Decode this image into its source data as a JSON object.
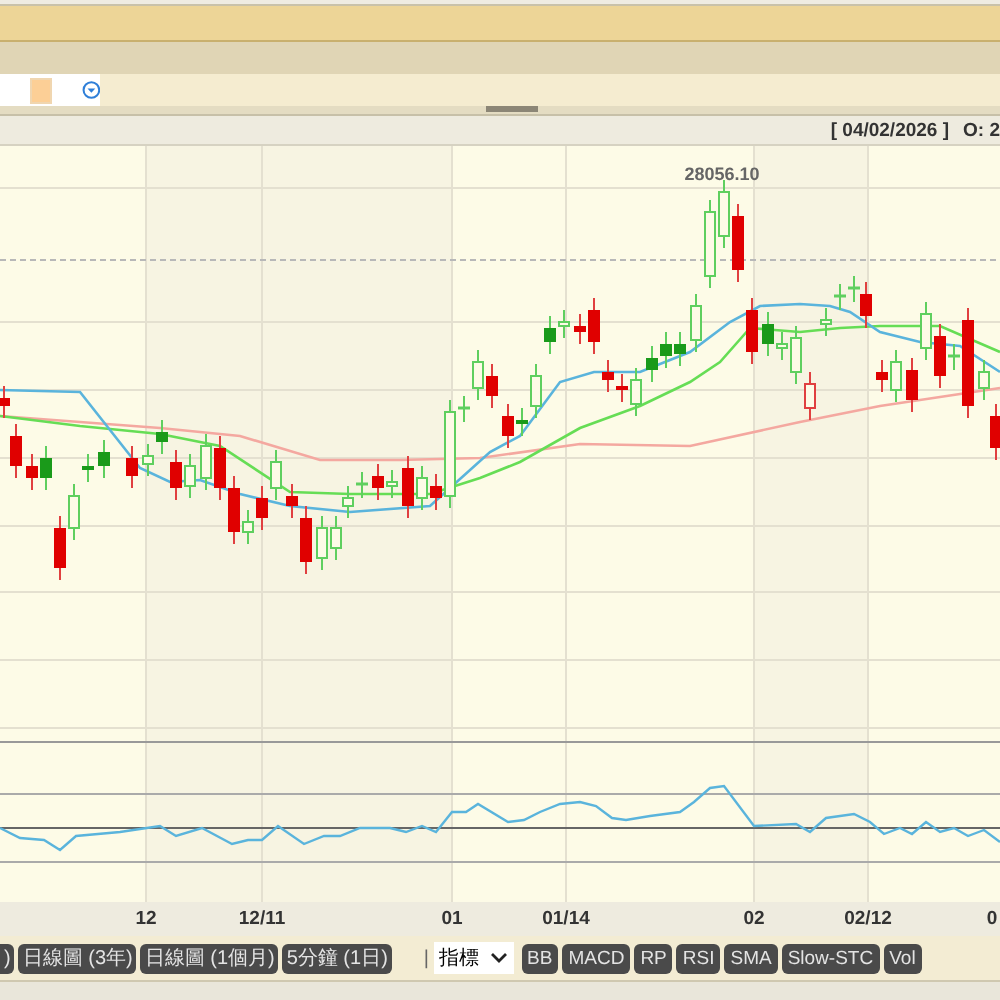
{
  "header": {
    "date": "[ 04/02/2026 ]",
    "open_label": "O: 2"
  },
  "chart": {
    "high_label": "28056.10",
    "x_labels": [
      "12",
      "12/11",
      "01",
      "01/14",
      "02",
      "02/12",
      "0"
    ]
  },
  "toolbar": {
    "range_buttons": [
      ")",
      "日線圖 (3年)",
      "日線圖 (1個月)",
      "5分鐘 (1日)"
    ],
    "separator": "|",
    "indicator_select": "指標",
    "indicator_buttons": [
      "BB",
      "MACD",
      "RP",
      "RSI",
      "SMA",
      "Slow-STC",
      "Vol"
    ]
  }
}
